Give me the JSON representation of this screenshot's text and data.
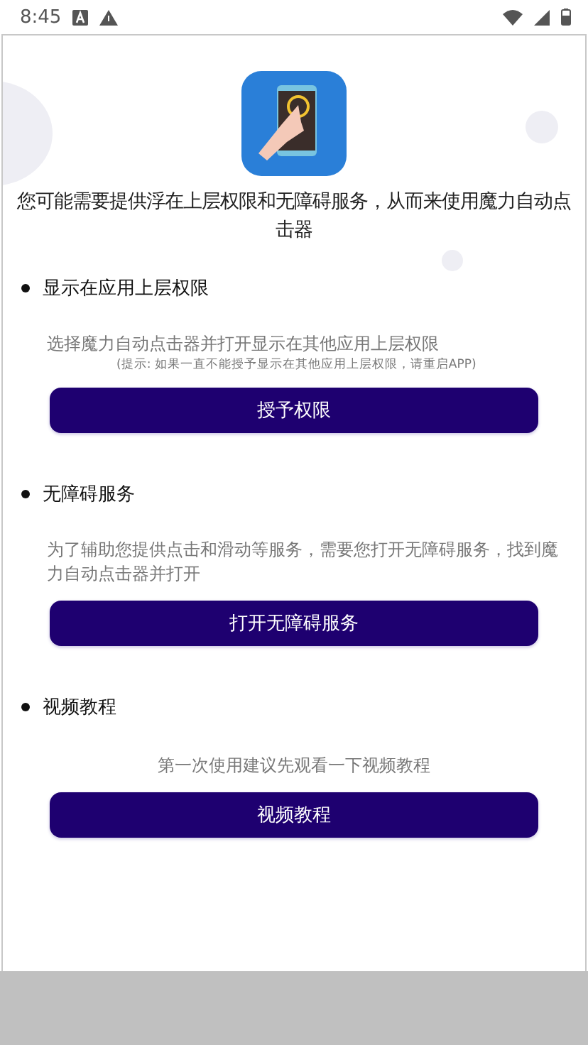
{
  "status_bar": {
    "time": "8:45"
  },
  "intro": "您可能需要提供浮在上层权限和无障碍服务，从而来使用魔力自动点击器",
  "sections": [
    {
      "heading": "显示在应用上层权限",
      "description": "选择魔力自动点击器并打开显示在其他应用上层权限",
      "hint": "(提示: 如果一直不能授予显示在其他应用上层权限，请重启APP)",
      "button": "授予权限"
    },
    {
      "heading": "无障碍服务",
      "description": "为了辅助您提供点击和滑动等服务，需要您打开无障碍服务，找到魔力自动点击器并打开",
      "button": "打开无障碍服务"
    },
    {
      "heading": "视频教程",
      "description": "第一次使用建议先观看一下视频教程",
      "button": "视频教程"
    }
  ]
}
